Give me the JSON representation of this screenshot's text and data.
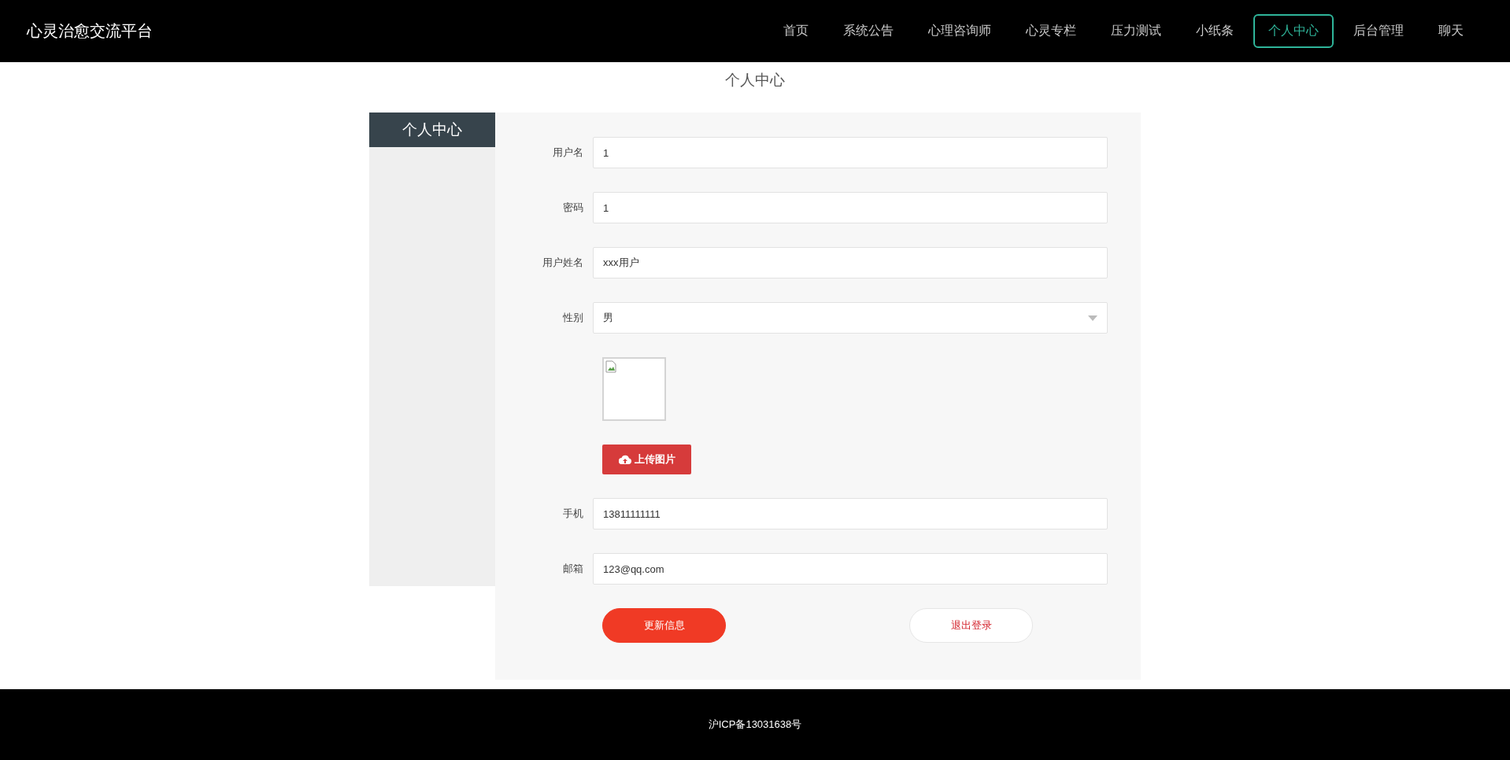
{
  "header": {
    "site_title": "心灵治愈交流平台",
    "nav": [
      {
        "label": "首页",
        "selected": false
      },
      {
        "label": "系统公告",
        "selected": false
      },
      {
        "label": "心理咨询师",
        "selected": false
      },
      {
        "label": "心灵专栏",
        "selected": false
      },
      {
        "label": "压力测试",
        "selected": false
      },
      {
        "label": "小纸条",
        "selected": false
      },
      {
        "label": "个人中心",
        "selected": true
      },
      {
        "label": "后台管理",
        "selected": false
      },
      {
        "label": "聊天",
        "selected": false
      }
    ]
  },
  "page_title": "个人中心",
  "sidebar": {
    "title": "个人中心"
  },
  "form": {
    "fields": [
      {
        "kind": "input",
        "label": "用户名",
        "value": "1"
      },
      {
        "kind": "input",
        "label": "密码",
        "value": "1"
      },
      {
        "kind": "input",
        "label": "用户姓名",
        "value": "xxx用户"
      },
      {
        "kind": "select",
        "label": "性别",
        "value": "男"
      },
      {
        "kind": "image",
        "upload_button": "上传图片"
      },
      {
        "kind": "input",
        "label": "手机",
        "value": "13811111111"
      },
      {
        "kind": "input",
        "label": "邮箱",
        "value": "123@qq.com"
      }
    ],
    "buttons": [
      {
        "kind": "primary",
        "label": "更新信息"
      },
      {
        "kind": "secondary",
        "label": "退出登录"
      }
    ]
  },
  "footer": {
    "text": "沪ICP备13031638号"
  }
}
